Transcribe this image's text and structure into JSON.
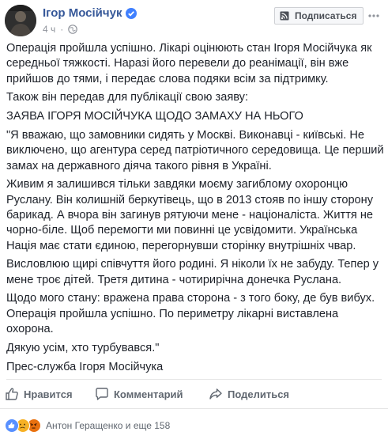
{
  "post": {
    "author": "Ігор Мосійчук",
    "time": "4 ч",
    "subscribe_label": "Подписаться",
    "paragraphs": [
      "Операція пройшла успішно. Лікарі оцінюють стан Ігоря Мосійчука як середньої тяжкості. Наразі його перевели до реанімації, він вже прийшов до тями, і передає слова подяки всім за підтримку.",
      "Також він передав для публікації свою заяву:",
      "ЗАЯВА ІГОРЯ МОСІЙЧУКА ЩОДО ЗАМАХУ НА НЬОГО",
      "\"Я вважаю, що замовники сидять у Москві. Виконавці - київські. Не виключено, що агентура серед патріотичного середовища. Це перший замах на державного діяча такого рівня в Україні.",
      "Живим я залишився тільки завдяки моєму загиблому охоронцю Руслану. Він колишній беркутівець, що в 2013 стояв по іншу сторону барикад. А вчора він загинув рятуючи мене - націоналіста. Життя не чорно-біле. Щоб перемогти ми повинні це усвідомити. Українська Нація має стати єдиною, перегорнувши сторінку внутрішніх чвар.",
      "Висловлюю щирі співчуття його родині. Я ніколи їх не забуду. Тепер у мене троє дітей. Третя дитина - чотирирічна донечка Руслана.",
      "Щодо мого стану: вражена права сторона - з того боку, де був вибух. Операція пройшла успішно. По периметру лікарні виставлена охорона.",
      "Дякую усім, хто турбувався.\"",
      "Прес-служба Ігоря Мосійчука"
    ]
  },
  "actions": {
    "like": "Нравится",
    "comment": "Комментарий",
    "share": "Поделиться"
  },
  "reactions": {
    "summary": "Антон Геращенко и еще 158",
    "icons": [
      "like-reaction",
      "sad-reaction",
      "angry-reaction"
    ]
  },
  "colors": {
    "author": "#365899",
    "meta": "#90949c",
    "text": "#1d2129",
    "action": "#606770",
    "like_blue": "#5890ff",
    "reaction_yellow": "#f7b125",
    "angry_orange": "#e9710f"
  }
}
